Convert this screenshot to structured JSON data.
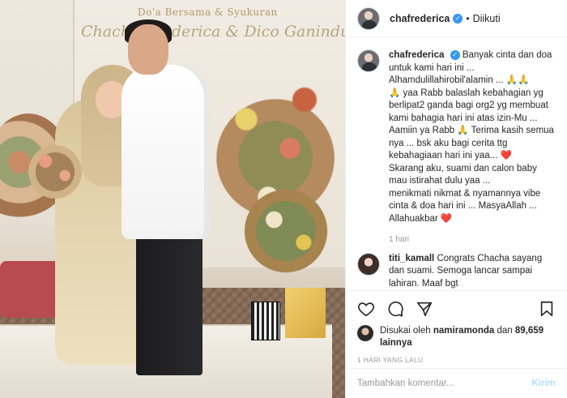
{
  "photo": {
    "banner_title": "Do'a Bersama & Syukuran",
    "banner_names": "Chacha Frederica & Dico Ganinduto"
  },
  "header": {
    "username": "chafrederica",
    "verified_mark": "✓",
    "separator": "•",
    "follow_status": "Diikuti"
  },
  "caption": {
    "username": "chafrederica",
    "lines": [
      "Banyak cinta dan doa untuk kami hari ini ...",
      "Alhamdulillahirobil'alamin ... 🙏🙏",
      "🙏 yaa Rabb balaslah kebahagian yg berlipat2 ganda bagi org2 yg membuat kami bahagia hari ini atas izin-Mu ... Aamiin ya Rabb 🙏 Terima kasih semua nya ... bsk aku bagi cerita ttg kebahagiaan hari ini yaa... ❤️",
      "Skarang aku, suami dan calon baby mau istirahat dulu yaa ...",
      "menikmati nikmat & nyamannya vibe cinta & doa hari ini ... MasyaAllah ... Allahuakbar ❤️"
    ],
    "time": "1 hari"
  },
  "comment": {
    "username": "titi_kamall",
    "text": "Congrats Chacha sayang dan suami. Semoga lancar sampai lahiran. Maaf bgt"
  },
  "actions": {
    "icons": [
      "heart-icon",
      "comment-icon",
      "share-icon",
      "bookmark-icon"
    ]
  },
  "likes": {
    "prefix": "Disukai oleh",
    "first_user": "namiramonda",
    "middle": "dan",
    "count": "89,659 lainnya"
  },
  "post_date": "1 HARI YANG LALU",
  "comment_box": {
    "placeholder": "Tambahkan komentar...",
    "post_label": "Kirim"
  },
  "colors": {
    "verified": "#3897f0",
    "post_button_disabled": "#b2dffc",
    "heart": "#ed4956",
    "muted_text": "#999999"
  }
}
